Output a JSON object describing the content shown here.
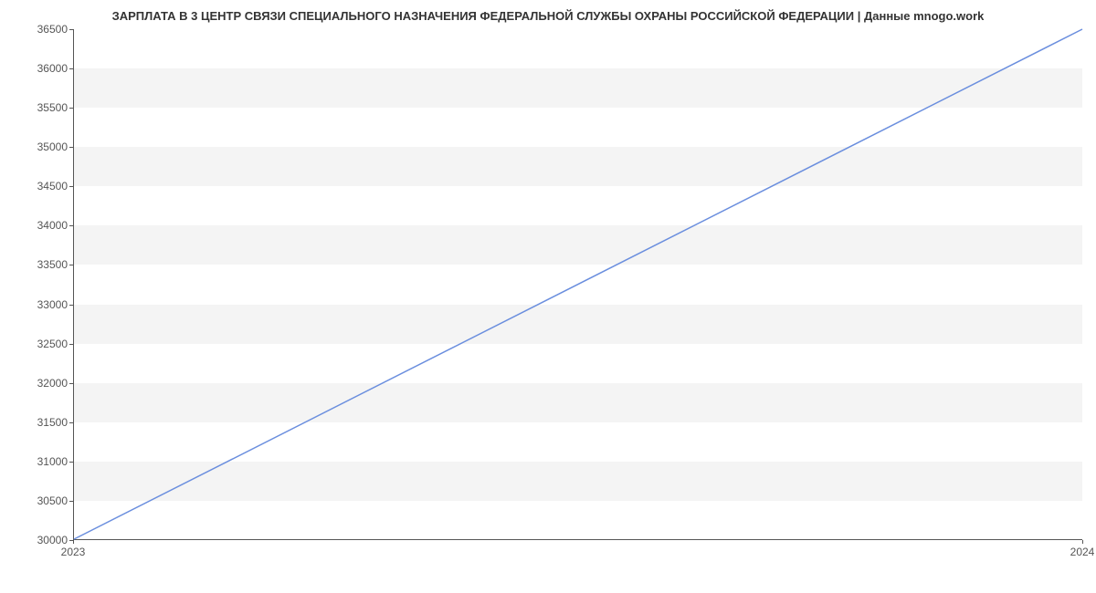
{
  "chart_data": {
    "type": "line",
    "title": "ЗАРПЛАТА В 3 ЦЕНТР СВЯЗИ СПЕЦИАЛЬНОГО НАЗНАЧЕНИЯ ФЕДЕРАЛЬНОЙ СЛУЖБЫ ОХРАНЫ РОССИЙСКОЙ ФЕДЕРАЦИИ | Данные mnogo.work",
    "x": [
      2023,
      2024
    ],
    "values": [
      30000,
      36500
    ],
    "xlabel": "",
    "ylabel": "",
    "xlim": [
      2023,
      2024
    ],
    "ylim": [
      30000,
      36500
    ],
    "x_ticks": [
      2023,
      2024
    ],
    "y_ticks": [
      30000,
      30500,
      31000,
      31500,
      32000,
      32500,
      33000,
      33500,
      34000,
      34500,
      35000,
      35500,
      36000,
      36500
    ],
    "line_color": "#6a8ede",
    "band_color": "#f4f4f4"
  }
}
